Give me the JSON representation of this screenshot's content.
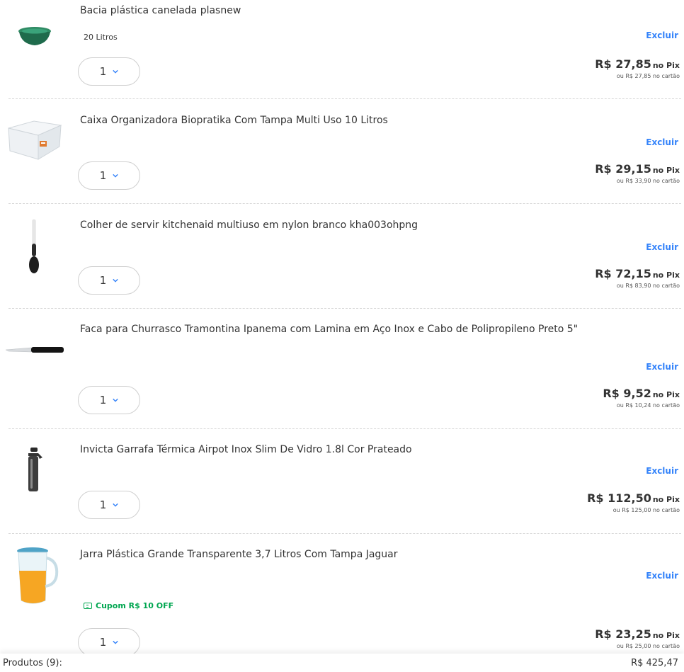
{
  "items": [
    {
      "title": "Bacia plástica canelada plasnew",
      "variant": "20 Litros",
      "remove_label": "Excluir",
      "qty": "1",
      "price_pix": "R$ 27,85",
      "pix_suffix": "no Pix",
      "price_card": "ou R$ 27,85 no cartão",
      "icon": "green-basin-icon"
    },
    {
      "title": "Caixa Organizadora Biopratika Com Tampa Multi Uso 10 Litros",
      "remove_label": "Excluir",
      "qty": "1",
      "price_pix": "R$ 29,15",
      "pix_suffix": "no Pix",
      "price_card": "ou R$ 33,90 no cartão",
      "icon": "storage-box-icon"
    },
    {
      "title": "Colher de servir kitchenaid multiuso em nylon branco kha003ohpng",
      "remove_label": "Excluir",
      "qty": "1",
      "price_pix": "R$ 72,15",
      "pix_suffix": "no Pix",
      "price_card": "ou R$ 83,90 no cartão",
      "icon": "spoon-icon"
    },
    {
      "title": "Faca para Churrasco Tramontina Ipanema com Lamina em Aço Inox e Cabo de Polipropileno Preto 5\"",
      "remove_label": "Excluir",
      "qty": "1",
      "price_pix": "R$ 9,52",
      "pix_suffix": "no Pix",
      "price_card": "ou R$ 10,24 no cartão",
      "icon": "knife-icon"
    },
    {
      "title": "Invicta Garrafa Térmica Airpot Inox Slim De Vidro 1.8l Cor Prateado",
      "remove_label": "Excluir",
      "qty": "1",
      "price_pix": "R$ 112,50",
      "pix_suffix": "no Pix",
      "price_card": "ou R$ 125,00 no cartão",
      "icon": "thermos-icon"
    },
    {
      "title": "Jarra Plástica Grande Transparente 3,7 Litros Com Tampa Jaguar",
      "coupon": "Cupom R$ 10 OFF",
      "remove_label": "Excluir",
      "qty": "1",
      "price_pix": "R$ 23,25",
      "pix_suffix": "no Pix",
      "price_card": "ou R$ 25,00 no cartão",
      "icon": "pitcher-icon"
    }
  ],
  "summary": {
    "label": "Produtos (9):",
    "total": "R$ 425,47"
  },
  "colors": {
    "link": "#3483fa",
    "coupon": "#00a650",
    "text": "#333333"
  }
}
